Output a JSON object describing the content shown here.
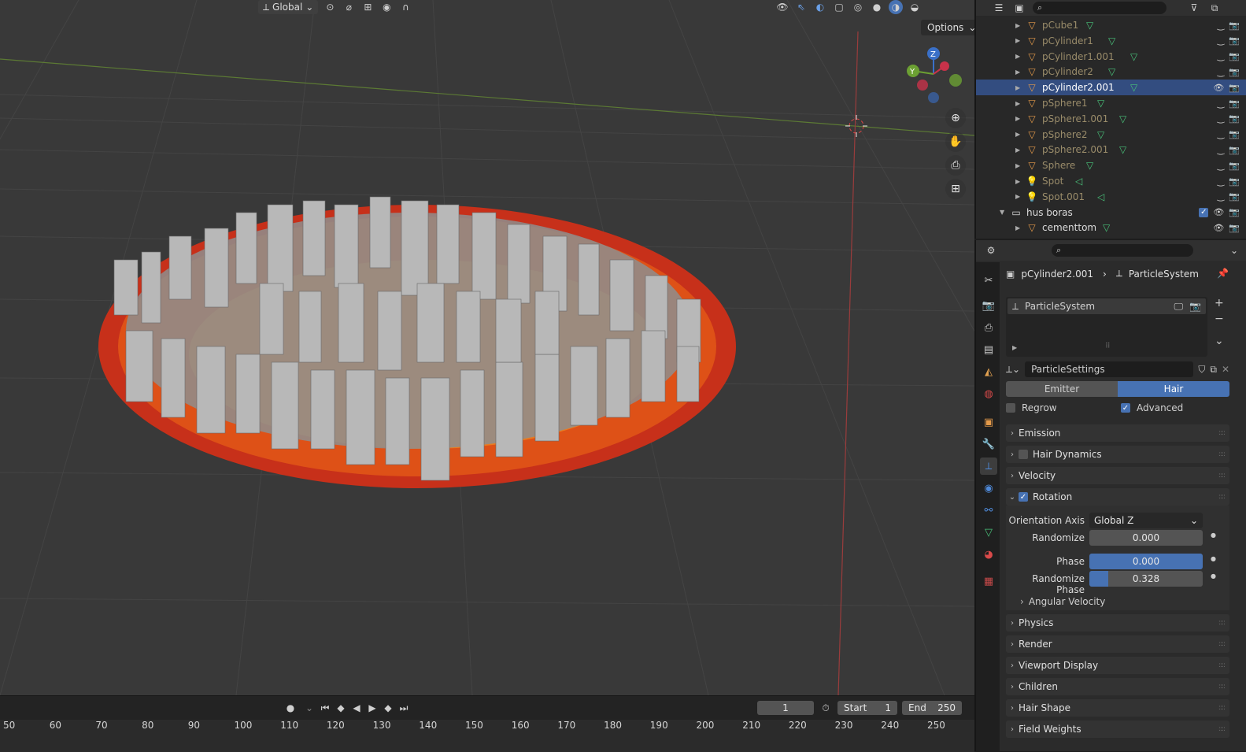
{
  "viewport": {
    "orientation_label": "Global",
    "options_label": "Options",
    "gizmo": {
      "z": "Z",
      "y": "Y"
    }
  },
  "timeline": {
    "current_frame": "1",
    "start_label": "Start",
    "start_value": "1",
    "end_label": "End",
    "end_value": "250",
    "ruler_ticks": [
      "50",
      "60",
      "70",
      "80",
      "90",
      "100",
      "110",
      "120",
      "130",
      "140",
      "150",
      "160",
      "170",
      "180",
      "190",
      "200",
      "210",
      "220",
      "230",
      "240",
      "250"
    ]
  },
  "outliner": {
    "items": [
      {
        "label": "pCube1",
        "type": "mesh"
      },
      {
        "label": "pCylinder1",
        "type": "mesh"
      },
      {
        "label": "pCylinder1.001",
        "type": "mesh"
      },
      {
        "label": "pCylinder2",
        "type": "mesh"
      },
      {
        "label": "pCylinder2.001",
        "type": "mesh",
        "selected": true
      },
      {
        "label": "pSphere1",
        "type": "mesh"
      },
      {
        "label": "pSphere1.001",
        "type": "mesh"
      },
      {
        "label": "pSphere2",
        "type": "mesh"
      },
      {
        "label": "pSphere2.001",
        "type": "mesh"
      },
      {
        "label": "Sphere",
        "type": "mesh"
      },
      {
        "label": "Spot",
        "type": "light"
      },
      {
        "label": "Spot.001",
        "type": "light"
      },
      {
        "label": "hus boras",
        "type": "collection"
      },
      {
        "label": "cementtom",
        "type": "mesh"
      }
    ]
  },
  "properties": {
    "breadcrumb": {
      "object": "pCylinder2.001",
      "system": "ParticleSystem"
    },
    "particle_system_name": "ParticleSystem",
    "settings_name": "ParticleSettings",
    "type_tabs": {
      "emitter": "Emitter",
      "hair": "Hair",
      "active": "Hair"
    },
    "regrow_label": "Regrow",
    "advanced_label": "Advanced",
    "panels": {
      "emission": "Emission",
      "hair_dynamics": "Hair Dynamics",
      "velocity": "Velocity",
      "rotation": "Rotation",
      "angular_velocity": "Angular Velocity",
      "physics": "Physics",
      "render": "Render",
      "viewport_display": "Viewport Display",
      "children": "Children",
      "hair_shape": "Hair Shape",
      "field_weights": "Field Weights"
    },
    "rotation": {
      "orientation_axis_label": "Orientation Axis",
      "orientation_axis_value": "Global Z",
      "randomize_label": "Randomize",
      "randomize_value": "0.000",
      "phase_label": "Phase",
      "phase_value": "0.000",
      "randomize_phase_label": "Randomize Phase",
      "randomize_phase_value": "0.328",
      "randomize_phase_fraction": 0.328
    }
  },
  "colors": {
    "accent": "#4772b3",
    "selected_row": "#334d80",
    "mesh_icon": "#49c27a",
    "object_icon": "#e49a4a"
  }
}
